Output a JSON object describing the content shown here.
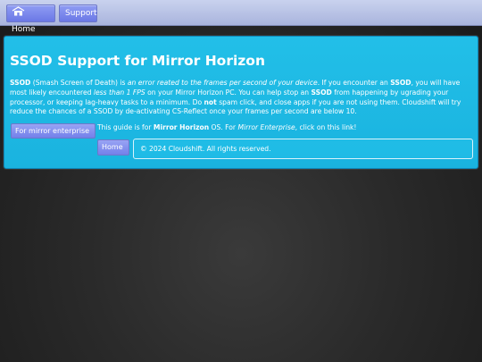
{
  "nav": {
    "home_label": "Home",
    "support_label": "Support"
  },
  "main": {
    "title": "SSOD Support for Mirror Horizon",
    "para": {
      "p1": "SSOD",
      "p2": " (Smash Screen of Death) is ",
      "p3": "an error reated to the frames per second of your device",
      "p4": ". If you encounter an ",
      "p5": "SSOD",
      "p6": ", you will have most likely encountered ",
      "p7": "less than 1 FPS",
      "p8": " on your Mirror Horizon PC. You can help stop an ",
      "p9": "SSOD",
      "p10": " from happening by ugrading your processor, or keeping lag-heavy tasks to a minimum. Do ",
      "p11": "not",
      "p12": " spam click, and close apps if you are not using them. Cloudshift will try reduce the chances of a SSOD by de-activating CS-Reflect once your frames per second are below 10."
    },
    "enterprise_button": "For mirror enterprise",
    "guide": {
      "g1": "This guide is for ",
      "g2": "Mirror Horizon",
      "g3": " OS. For ",
      "g4": "Mirror Enterprise",
      "g5": ", click on this link!"
    },
    "home_button": "Home",
    "footer": "© 2024 Cloudshift. All rights reserved."
  },
  "colors": {
    "panel": "#1ab3df",
    "button": "#7380ea",
    "nav_bar": "#b5bfe6"
  },
  "icons": {
    "home": "home-icon"
  }
}
